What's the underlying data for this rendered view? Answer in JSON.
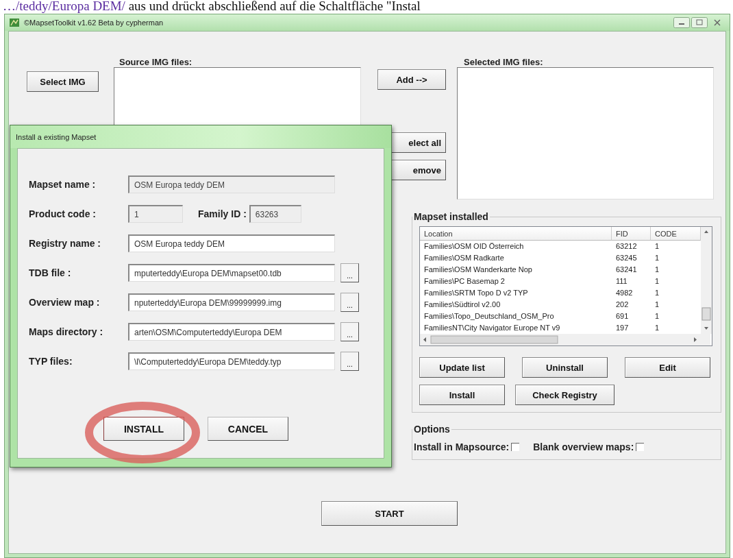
{
  "web_text": {
    "link": "…/teddy/Europa DEM/",
    "sentence": "aus und drückt abschließend auf die Schaltfläche \"Instal"
  },
  "window": {
    "title": "©MapsetToolkit v1.62 Beta by cypherman"
  },
  "source": {
    "label": "Source IMG files:",
    "select_button": "Select IMG"
  },
  "side_buttons": [
    "Add -->",
    "elect all",
    "emove"
  ],
  "selected": {
    "label": "Selected IMG files:"
  },
  "mapset_installed": {
    "title": "Mapset installed",
    "columns": [
      "Location",
      "FID",
      "CODE"
    ],
    "rows": [
      [
        "Families\\OSM OID Österreich",
        "63212",
        "1"
      ],
      [
        "Families\\OSM Radkarte",
        "63245",
        "1"
      ],
      [
        "Families\\OSM Wanderkarte Nop",
        "63241",
        "1"
      ],
      [
        "Families\\PC Basemap 2",
        "111",
        "1"
      ],
      [
        "Families\\SRTM Topo D v2 TYP",
        "4982",
        "1"
      ],
      [
        "Families\\Südtirol v2.00",
        "202",
        "1"
      ],
      [
        "Families\\Topo_Deutschland_OSM_Pro",
        "691",
        "1"
      ],
      [
        "FamiliesNT\\City Navigator Europe NT v9",
        "197",
        "1"
      ]
    ],
    "buttons": [
      [
        "Update list",
        "Uninstall",
        "Edit"
      ],
      [
        "Install",
        "Check Registry"
      ]
    ]
  },
  "options": {
    "title": "Options",
    "checkboxes": [
      {
        "label": "Install in Mapsource:",
        "checked": false
      },
      {
        "label": "Blank overview maps:",
        "checked": false
      }
    ]
  },
  "start_button": "START",
  "dialog": {
    "title": "Install a existing Mapset",
    "rows": [
      {
        "kind": "text",
        "label": "Mapset name :",
        "value": "OSM Europa teddy DEM",
        "disabled": true
      },
      {
        "kind": "pair",
        "label": "Product code :",
        "value": "1",
        "disabled": true,
        "label2": "Family ID :",
        "value2": "63263",
        "disabled2": true
      },
      {
        "kind": "text",
        "label": "Registry name :",
        "value": "OSM Europa teddy DEM",
        "disabled": false
      },
      {
        "kind": "browse",
        "label": "TDB file :",
        "value": "mputerteddy\\Europa DEM\\mapset00.tdb",
        "button": "..."
      },
      {
        "kind": "browse",
        "label": "Overview map :",
        "value": "nputerteddy\\Europa DEM\\99999999.img",
        "button": "..."
      },
      {
        "kind": "browse",
        "label": "Maps directory :",
        "value": "arten\\OSM\\Computerteddy\\Europa DEM",
        "button": "..."
      },
      {
        "kind": "browse",
        "label": "TYP files:",
        "value": "\\l\\Computerteddy\\Europa DEM\\teddy.typ",
        "button": "..."
      }
    ],
    "buttons": [
      {
        "label": "INSTALL",
        "highlighted": true
      },
      {
        "label": "CANCEL",
        "highlighted": false
      }
    ]
  }
}
